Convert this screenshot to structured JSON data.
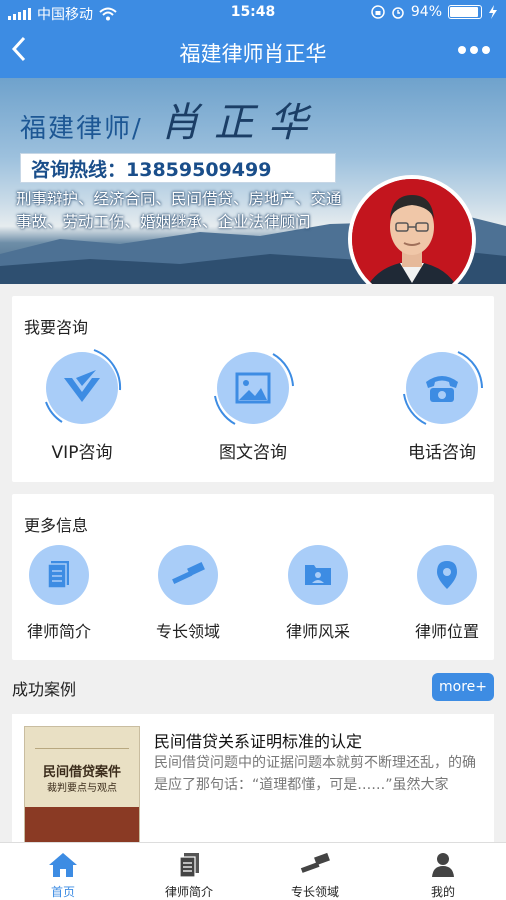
{
  "status": {
    "carrier": "中国移动",
    "time": "15:48",
    "battery": "94%"
  },
  "nav": {
    "title": "福建律师肖正华",
    "back_icon": "back-chevron-icon",
    "more_icon": "more-dots-icon"
  },
  "banner": {
    "title": "福建律师/",
    "name": "肖正华",
    "hotline": "咨询热线：13859509499",
    "services": "刑事辩护、经济合同、民间借贷、房地产、交通事故、劳动工伤、婚姻继承、企业法律顾问",
    "slide_count": 2,
    "active_slide": 1
  },
  "consult": {
    "heading": "我要咨询",
    "items": [
      {
        "label": "VIP咨询",
        "icon": "vip-icon"
      },
      {
        "label": "图文咨询",
        "icon": "image-icon"
      },
      {
        "label": "电话咨询",
        "icon": "phone-icon"
      }
    ]
  },
  "info": {
    "heading": "更多信息",
    "items": [
      {
        "label": "律师简介",
        "icon": "document-icon"
      },
      {
        "label": "专长领域",
        "icon": "gavel-icon"
      },
      {
        "label": "律师风采",
        "icon": "photo-folder-icon"
      },
      {
        "label": "律师位置",
        "icon": "location-pin-icon"
      }
    ]
  },
  "cases": {
    "heading": "成功案例",
    "more_label": "more+",
    "items": [
      {
        "title": "民间借贷关系证明标准的认定",
        "desc": "民间借贷问题中的证据问题本就剪不断理还乱，的确是应了那句话：“道理都懂，可是……”虽然大家",
        "book_title": "民间借贷案件",
        "book_subtitle": "裁判要点与观点"
      }
    ]
  },
  "tabbar": {
    "items": [
      {
        "label": "首页",
        "icon": "home-icon",
        "active": true
      },
      {
        "label": "律师简介",
        "icon": "document-icon",
        "active": false
      },
      {
        "label": "专长领域",
        "icon": "gavel-icon",
        "active": false
      },
      {
        "label": "我的",
        "icon": "user-icon",
        "active": false
      }
    ]
  },
  "colors": {
    "primary": "#3d8ce3",
    "icon_bg": "#a9cdf8",
    "icon_fg": "#3d8ce3"
  }
}
